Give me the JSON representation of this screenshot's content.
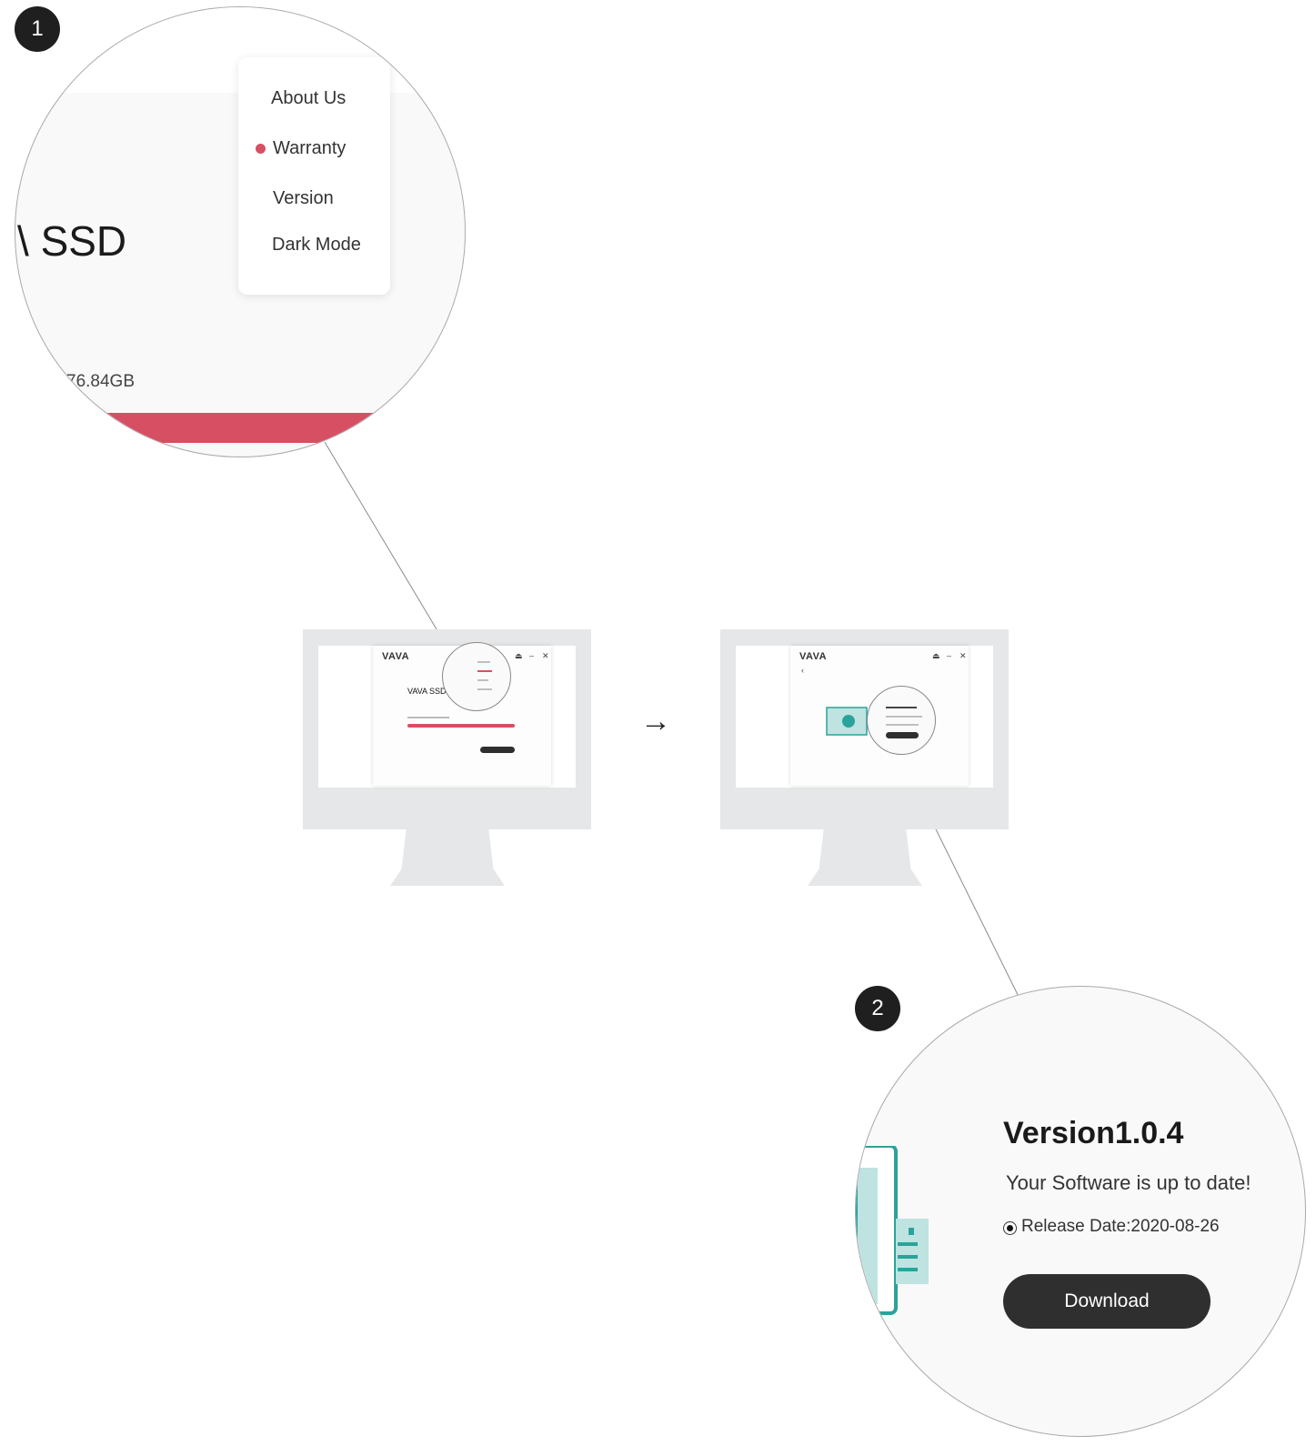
{
  "steps": {
    "one": "1",
    "two": "2"
  },
  "zoom_menu": {
    "items": [
      "About Us",
      "Warranty",
      "Version",
      "Dark Mode"
    ],
    "ssd_label": "SSD",
    "capacity": "76.84GB",
    "accent_color": "#d64f63"
  },
  "monitor_left": {
    "logo": "VAVA",
    "ssd_title": "VAVA SSD"
  },
  "monitor_right": {
    "logo": "VAVA"
  },
  "zoom_version": {
    "title": "Version1.0.4",
    "status": "Your Software is up to date!",
    "release": "Release Date:2020-08-26",
    "download_label": "Download",
    "illustration_color": "#2aa39a"
  },
  "arrow_icon": "arrow-right-icon"
}
